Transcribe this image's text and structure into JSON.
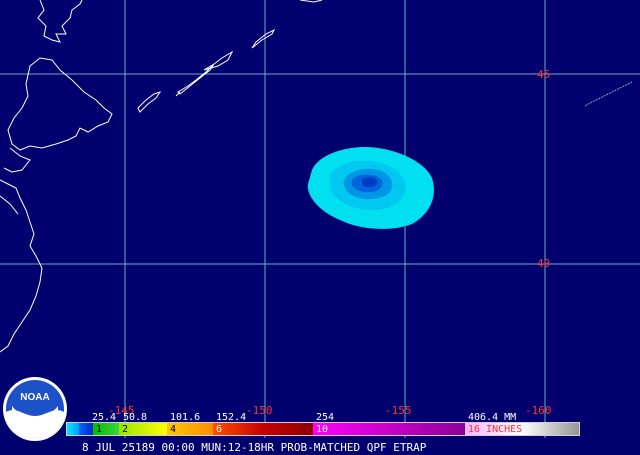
{
  "map": {
    "lat_labels": [
      "45",
      "40"
    ],
    "lon_labels": [
      "-145",
      "-150",
      "-155",
      "-160"
    ]
  },
  "legend": {
    "mm_values": [
      "25.4",
      "50.8",
      "101.6",
      "152.4",
      "254",
      "406.4 MM"
    ],
    "inch_values": [
      "1",
      "2",
      "4",
      "6",
      "10",
      "16 INCHES"
    ]
  },
  "caption": "8 JUL 25189 00:00 MUN:12-18HR PROB-MATCHED QPF ETRAP",
  "logo": {
    "text": "NOAA"
  },
  "colors": {
    "background": "#00006e",
    "grid": "#5ab4c8",
    "coast": "#ffffff",
    "label": "#ff3030"
  }
}
